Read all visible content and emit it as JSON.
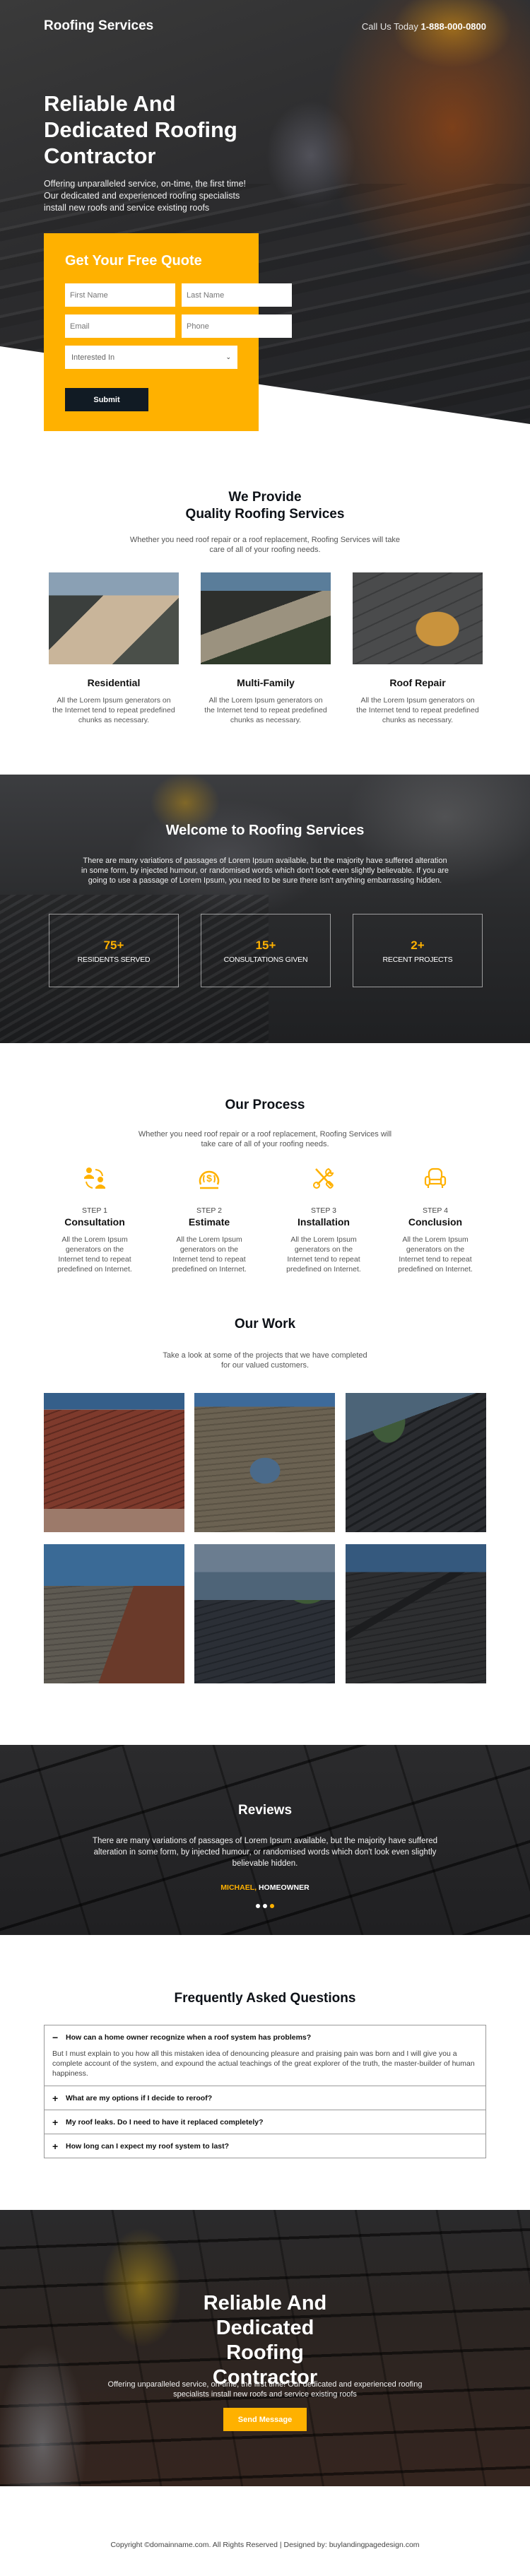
{
  "header": {
    "brand": "Roofing Services",
    "phone_label": "Call Us Today",
    "phone_number": "1-888-000-0800"
  },
  "hero": {
    "title": "Reliable And Dedicated Roofing Contractor",
    "subtitle": "Offering unparalleled service, on-time, the first time! Our dedicated and experienced roofing specialists install new roofs and service existing roofs"
  },
  "quote_form": {
    "title": "Get Your Free Quote",
    "first_name_placeholder": "First Name",
    "last_name_placeholder": "Last Name",
    "email_placeholder": "Email",
    "phone_placeholder": "Phone",
    "interest_selected": "Interested In",
    "submit_label": "Submit"
  },
  "services": {
    "title_line1": "We Provide",
    "title_line2": "Quality Roofing Services",
    "subtitle": "Whether you need roof repair or a roof replacement, Roofing Services will take care of all of your roofing needs.",
    "items": [
      {
        "title": "Residential",
        "text": "All the Lorem Ipsum generators on the Internet tend to repeat predefined chunks as necessary.",
        "image": "house-photo"
      },
      {
        "title": "Multi-Family",
        "text": "All the Lorem Ipsum generators on the Internet tend to repeat predefined chunks as necessary.",
        "image": "multi-family-photo"
      },
      {
        "title": "Roof Repair",
        "text": "All the Lorem Ipsum generators on the Internet tend to repeat predefined chunks as necessary.",
        "image": "gloves-hammer-photo"
      }
    ]
  },
  "welcome": {
    "title": "Welcome to Roofing Services",
    "text": "There are many variations of passages of Lorem Ipsum available, but the majority have suffered alteration in some form, by injected humour, or randomised words which don't look even slightly believable. If you are going to use a passage of Lorem Ipsum, you need to be sure there isn't anything embarrassing hidden.",
    "stats": [
      {
        "value": "75+",
        "label": "RESIDENTS SERVED"
      },
      {
        "value": "15+",
        "label": "CONSULTATIONS GIVEN"
      },
      {
        "value": "2+",
        "label": "RECENT PROJECTS"
      }
    ]
  },
  "process": {
    "title": "Our Process",
    "subtitle": "Whether you need roof repair or a roof replacement, Roofing Services will take care of all of your roofing needs.",
    "steps": [
      {
        "step": "STEP 1",
        "title": "Consultation",
        "text": "All the Lorem Ipsum generators on the Internet tend to repeat predefined on Internet.",
        "icon": "consultation-icon"
      },
      {
        "step": "STEP 2",
        "title": "Estimate",
        "text": "All the Lorem Ipsum generators on the Internet tend to repeat predefined on Internet.",
        "icon": "dollar-estimate-icon"
      },
      {
        "step": "STEP 3",
        "title": "Installation",
        "text": "All the Lorem Ipsum generators on the Internet tend to repeat predefined on Internet.",
        "icon": "tools-icon"
      },
      {
        "step": "STEP 4",
        "title": "Conclusion",
        "text": "All the Lorem Ipsum generators on the Internet tend to repeat predefined on Internet.",
        "icon": "armchair-icon"
      }
    ]
  },
  "work": {
    "title": "Our Work",
    "subtitle": "Take a look at some of the projects that we have completed for our valued customers.",
    "images": [
      "red-tile-roof",
      "shingle-dormer-roof",
      "dark-tile-roof",
      "brick-gable-roof",
      "lakeside-roof",
      "dark-shingle-roof"
    ]
  },
  "reviews": {
    "title": "Reviews",
    "text": "There are many variations of passages of Lorem Ipsum available, but the majority have suffered alteration in some form, by injected humour, or randomised words which don't look even slightly believable hidden.",
    "name": "MICHAEL,",
    "role": "HOMEOWNER",
    "slide_count": 3,
    "active_slide": 3
  },
  "faq": {
    "title": "Frequently Asked Questions",
    "items": [
      {
        "sign": "−",
        "question": "How can a home owner recognize when a roof system has problems?",
        "answer": "But I must explain to you how all this mistaken idea of denouncing pleasure and praising pain was born and I will give you a complete account of the system, and expound the actual teachings of the great explorer of the truth, the master-builder of human happiness.",
        "open": true
      },
      {
        "sign": "+",
        "question": "What are my options if I decide to reroof?",
        "open": false
      },
      {
        "sign": "+",
        "question": "My roof leaks. Do I need to have it replaced completely?",
        "open": false
      },
      {
        "sign": "+",
        "question": "How long can I expect my roof system to last?",
        "open": false
      }
    ]
  },
  "cta": {
    "title": "Reliable And Dedicated Roofing Contractor",
    "subtitle": "Offering unparalleled service, on-time, the first time! Our dedicated and experienced roofing specialists install new roofs and service existing roofs",
    "button_label": "Send Message"
  },
  "footer": {
    "text": "Copyright ©domainname.com. All Rights Reserved | Designed by: buylandingpagedesign.com"
  },
  "colors": {
    "accent": "#ffb100",
    "dark": "#111b24",
    "text": "#0d1117"
  }
}
